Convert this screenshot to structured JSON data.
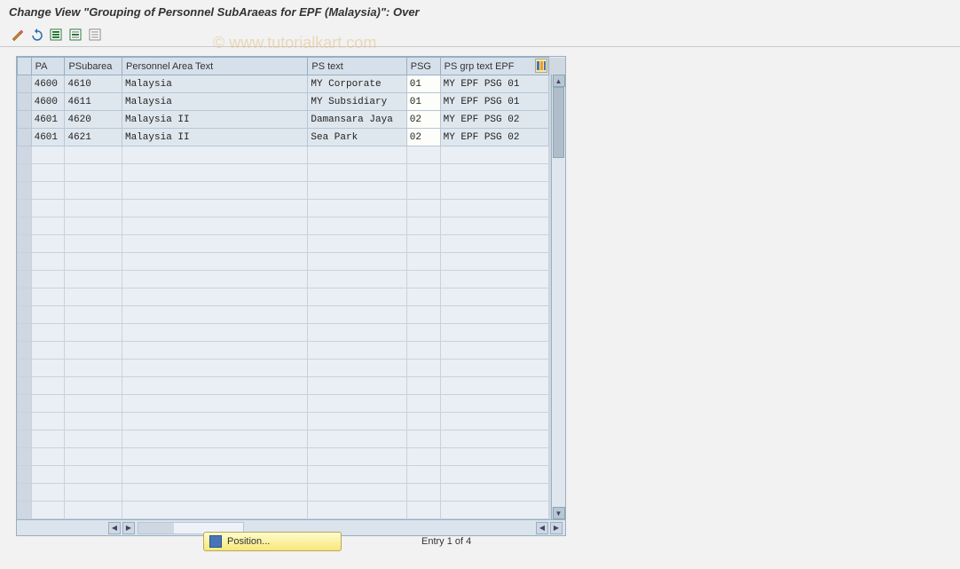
{
  "title": "Change View \"Grouping of Personnel SubAraeas for EPF (Malaysia)\": Over",
  "watermark": "© www.tutorialkart.com",
  "toolbar_icons": [
    "toggle-display-change",
    "undo",
    "select-all",
    "deselect-all",
    "configuration"
  ],
  "columns": {
    "pa": "PA",
    "psubarea": "PSubarea",
    "patext": "Personnel Area Text",
    "pstext": "PS text",
    "psg": "PSG",
    "psgrptext": "PS grp text EPF"
  },
  "rows": [
    {
      "pa": "4600",
      "psubarea": "4610",
      "patext": "Malaysia",
      "pstext": "MY Corporate",
      "psg": "01",
      "psgrptext": "MY EPF PSG 01"
    },
    {
      "pa": "4600",
      "psubarea": "4611",
      "patext": "Malaysia",
      "pstext": "MY Subsidiary",
      "psg": "01",
      "psgrptext": "MY EPF PSG 01"
    },
    {
      "pa": "4601",
      "psubarea": "4620",
      "patext": "Malaysia II",
      "pstext": "Damansara Jaya",
      "psg": "02",
      "psgrptext": "MY EPF PSG 02"
    },
    {
      "pa": "4601",
      "psubarea": "4621",
      "patext": "Malaysia II",
      "pstext": "Sea Park",
      "psg": "02",
      "psgrptext": "MY EPF PSG 02"
    }
  ],
  "empty_row_count": 21,
  "footer": {
    "position_button": "Position...",
    "entry_text": "Entry 1 of 4"
  }
}
